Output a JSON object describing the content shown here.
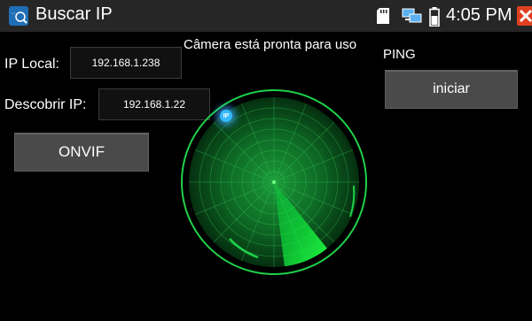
{
  "app": {
    "title": "Buscar IP"
  },
  "statusbar": {
    "time": "4:05 PM"
  },
  "status_message": "Câmera está pronta para uso",
  "local_ip": {
    "label": "IP Local:",
    "value": "192.168.1.238"
  },
  "discover_ip": {
    "label": "Descobrir IP:",
    "value": "192.168.1.22"
  },
  "buttons": {
    "onvif": "ONVIF",
    "iniciar": "iniciar"
  },
  "ping": {
    "label": "PING"
  },
  "radar": {
    "blip_label": "IP"
  },
  "colors": {
    "radar_green": "#1fd14a",
    "blip_blue": "#35b9ff",
    "topbar": "#262626",
    "close_red": "#e04020"
  }
}
